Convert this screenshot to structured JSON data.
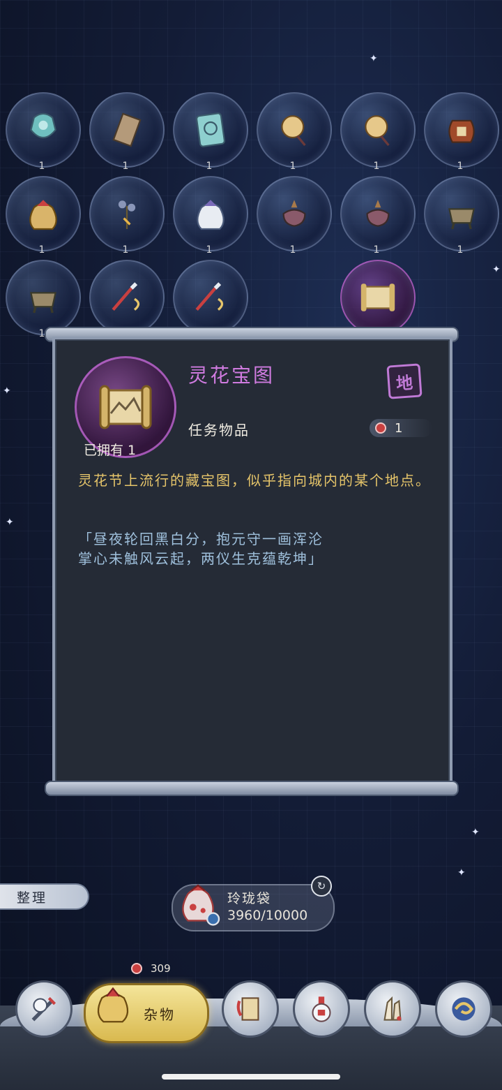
{
  "inventory": {
    "rows": [
      [
        {
          "icon": "jade-ornament-icon",
          "count": "1"
        },
        {
          "icon": "scroll-paper-icon",
          "count": "1"
        },
        {
          "icon": "rain-talisman-icon",
          "count": "1"
        },
        {
          "icon": "gold-medallion-icon",
          "count": "1"
        },
        {
          "icon": "gold-medallion-icon",
          "count": "1"
        },
        {
          "icon": "wine-jar-icon",
          "count": "1"
        }
      ],
      [
        {
          "icon": "gold-pouch-icon",
          "count": "1"
        },
        {
          "icon": "flower-sprig-icon",
          "count": "1"
        },
        {
          "icon": "white-pouch-icon",
          "count": "1"
        },
        {
          "icon": "incense-burner-icon",
          "count": "1"
        },
        {
          "icon": "incense-burner-icon",
          "count": "1"
        },
        {
          "icon": "bronze-cauldron-icon",
          "count": "1"
        }
      ],
      [
        {
          "icon": "bronze-cauldron-icon",
          "count": "1"
        },
        {
          "icon": "brush-icon",
          "count": ""
        },
        {
          "icon": "brush-icon",
          "count": ""
        },
        {
          "icon": "empty",
          "count": ""
        },
        {
          "icon": "treasure-map-icon",
          "count": "",
          "selected": true
        }
      ]
    ]
  },
  "detail": {
    "title": "灵花宝图",
    "grade_badge": "地",
    "type": "任务物品",
    "price": "1",
    "owned": "已拥有 1",
    "description": "灵花节上流行的藏宝图，似乎指向城内的某个地点。",
    "poem_line1": "「昼夜轮回黑白分，抱元守一画浑沦",
    "poem_line2": "掌心未触风云起，两仪生克蕴乾坤」"
  },
  "organize_label": "整理",
  "bag": {
    "name": "玲珑袋",
    "capacity": "3960/10000"
  },
  "nav": {
    "count": "309",
    "active_label": "杂物",
    "items": [
      "weapon-icon",
      "misc-pouch-icon",
      "book-icon",
      "potion-icon",
      "crystal-icon",
      "spiral-icon"
    ]
  },
  "colors": {
    "title": "#d07be0",
    "description": "#e6c56a",
    "poem": "#9fc0dc",
    "active_tab": "#f4e59a"
  }
}
